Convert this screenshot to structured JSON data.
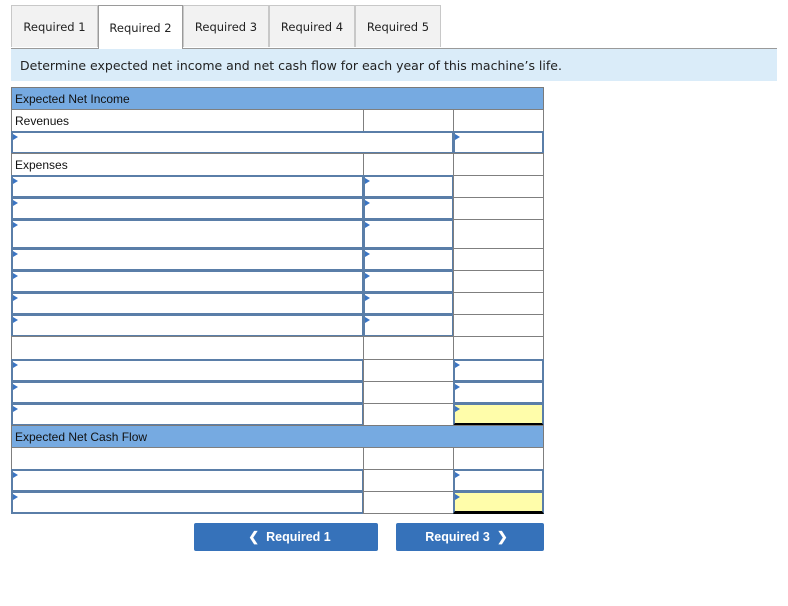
{
  "tabs": [
    {
      "label": "Required 1",
      "active": false
    },
    {
      "label": "Required 2",
      "active": true
    },
    {
      "label": "Required 3",
      "active": false
    },
    {
      "label": "Required 4",
      "active": false
    },
    {
      "label": "Required 5",
      "active": false
    }
  ],
  "instruction": "Determine expected net income and net cash flow for each year of this machine’s life.",
  "worksheet": {
    "net_income_header": "Expected Net Income",
    "revenues_label": "Revenues",
    "revenue_row": {
      "account": "",
      "amount": ""
    },
    "expenses_label": "Expenses",
    "expense_rows": [
      {
        "account": "",
        "amount": ""
      },
      {
        "account": "",
        "amount": ""
      },
      {
        "account": "",
        "amount": ""
      },
      {
        "account": "",
        "amount": ""
      },
      {
        "account": "",
        "amount": ""
      },
      {
        "account": "",
        "amount": ""
      },
      {
        "account": "",
        "amount": ""
      }
    ],
    "income_rows": [
      {
        "account": "",
        "amount": ""
      },
      {
        "account": "",
        "amount": ""
      },
      {
        "account": "",
        "amount": "",
        "highlight": true
      }
    ],
    "cash_flow_header": "Expected Net Cash Flow",
    "cash_flow_rows": [
      {
        "account": "",
        "amount": ""
      },
      {
        "account": "",
        "amount": "",
        "highlight": true
      }
    ],
    "highlight_color": "#fffdaa",
    "header_color": "#76aae1",
    "input_border_color": "#5a7ea8"
  },
  "nav": {
    "prev_label": "Required 1",
    "next_label": "Required 3",
    "prev_icon": "chevron-left-icon",
    "next_icon": "chevron-right-icon",
    "button_color": "#3672ba"
  }
}
